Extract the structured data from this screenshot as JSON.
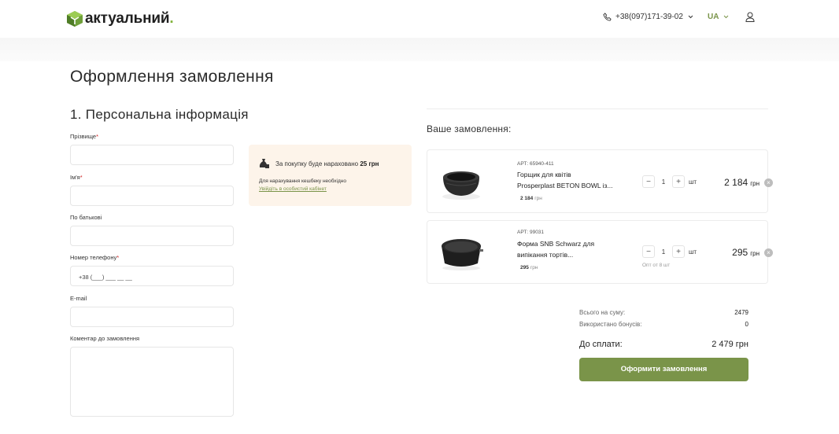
{
  "header": {
    "logo_text": "актуальний",
    "logo_dot": ".",
    "phone": "+38(097)171-39-02",
    "lang": "UA"
  },
  "page": {
    "title": "Оформлення замовлення",
    "section_title": "1.  Персональна інформація"
  },
  "form": {
    "surname_label": "Прізвище",
    "name_label": "Ім'я",
    "patronymic_label": "По батькові",
    "phone_label": "Номер телефону",
    "phone_value": "+38 (___) ___ __ __",
    "email_label": "E-mail",
    "comment_label": "Коментар до замовлення",
    "required_mark": "*"
  },
  "cashback": {
    "text": "За покупку буде нараховано",
    "amount": "25 грн",
    "note": "Для нарахування кешбеку необхідно",
    "link": "Увійдіть в особистий кабінет"
  },
  "order": {
    "title": "Ваше замовлення:",
    "items": [
      {
        "art": "АРТ: 65940-411",
        "name_line1": "Горщик для квітів",
        "name_line2": "Prosperplast BETON BOWL із...",
        "unit_price": "2 184",
        "unit_currency": "грн",
        "qty": "1",
        "qty_unit": "шт",
        "total": "2 184",
        "total_currency": "грн",
        "minus": "−",
        "plus": "+",
        "remove": "×"
      },
      {
        "art": "АРТ: 99031",
        "name_line1": "Форма SNB Schwarz для",
        "name_line2": "випікання тортів...",
        "unit_price": "295",
        "unit_currency": "грн",
        "qty": "1",
        "qty_unit": "шт",
        "opt_note": "Опт от 8 шт",
        "total": "295",
        "total_currency": "грн",
        "minus": "−",
        "plus": "+",
        "remove": "×"
      }
    ]
  },
  "summary": {
    "subtotal_label": "Всього на суму:",
    "subtotal_value": "2479",
    "bonus_label": "Використано бонусів:",
    "bonus_value": "0",
    "pay_label": "До сплати:",
    "pay_value": "2 479 грн",
    "submit_label": "Оформити замовлення"
  },
  "colors": {
    "accent": "#7a9449",
    "logo_green": "#82b33c",
    "cashback_bg": "#fdf4ea",
    "required": "#d02020"
  },
  "icons": [
    "logo-mark-icon",
    "phone-icon",
    "chevron-down-icon",
    "user-icon",
    "money-bag-icon",
    "close-icon"
  ]
}
